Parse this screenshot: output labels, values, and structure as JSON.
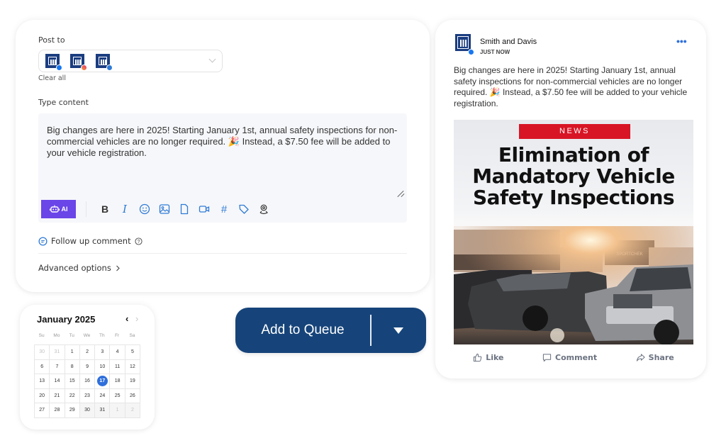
{
  "composer": {
    "post_to_label": "Post to",
    "accounts": [
      {
        "name": "Smith and Davis",
        "network": "facebook",
        "badge_color": "#1877f2"
      },
      {
        "name": "Smith and Davis",
        "network": "instagram",
        "badge_color": "#e1306c"
      },
      {
        "name": "Smith and Davis",
        "network": "linkedin",
        "badge_color": "#2f7bd6"
      }
    ],
    "clear_all": "Clear all",
    "type_content_label": "Type content",
    "content": "Big changes are here in 2025! Starting January 1st, annual safety inspections for non-commercial vehicles are no longer required. 🎉 Instead, a $7.50 fee will be added to your vehicle registration.",
    "toolbar": {
      "ai_label": "AI",
      "tools": [
        "bold-icon",
        "italic-icon",
        "emoji-icon",
        "image-icon",
        "file-icon",
        "video-icon",
        "hashtag-icon",
        "tag-icon",
        "location-icon"
      ],
      "bold_glyph": "B",
      "italic_glyph": "I",
      "hashtag_glyph": "#"
    },
    "follow_up_label": "Follow up comment",
    "advanced_label": "Advanced options",
    "ai_color": "#6a45e8",
    "icon_color": "#2f7bd6"
  },
  "calendar": {
    "title": "January 2025",
    "prev": "‹",
    "next": "›",
    "weekdays": [
      "Su",
      "Mo",
      "Tu",
      "We",
      "Th",
      "Fr",
      "Sa"
    ],
    "days": [
      {
        "d": "30",
        "muted": true
      },
      {
        "d": "31",
        "muted": true
      },
      {
        "d": "1"
      },
      {
        "d": "2"
      },
      {
        "d": "3"
      },
      {
        "d": "4"
      },
      {
        "d": "5"
      },
      {
        "d": "6"
      },
      {
        "d": "7"
      },
      {
        "d": "8"
      },
      {
        "d": "9"
      },
      {
        "d": "10"
      },
      {
        "d": "11"
      },
      {
        "d": "12"
      },
      {
        "d": "13"
      },
      {
        "d": "14"
      },
      {
        "d": "15"
      },
      {
        "d": "16"
      },
      {
        "d": "17",
        "selected": true
      },
      {
        "d": "18"
      },
      {
        "d": "19"
      },
      {
        "d": "20"
      },
      {
        "d": "21"
      },
      {
        "d": "22"
      },
      {
        "d": "23"
      },
      {
        "d": "24"
      },
      {
        "d": "25"
      },
      {
        "d": "26"
      },
      {
        "d": "27"
      },
      {
        "d": "28"
      },
      {
        "d": "29"
      },
      {
        "d": "30",
        "shade": true
      },
      {
        "d": "31",
        "shade": true
      },
      {
        "d": "1",
        "muted": true,
        "shade": true
      },
      {
        "d": "2",
        "muted": true,
        "shade": true
      }
    ],
    "selected_color": "#2f6fdc"
  },
  "queue_button": {
    "label": "Add to Queue",
    "color": "#16447a"
  },
  "preview": {
    "page_name": "Smith and Davis",
    "timestamp": "JUST NOW",
    "more": "•••",
    "text": "Big changes are here in 2025! Starting January 1st, annual safety inspections for non-commercial vehicles are no longer required. 🎉 Instead, a $7.50 fee will be added to your vehicle registration.",
    "image": {
      "tag": "NEWS",
      "headline": "Elimination of Mandatory Vehicle Safety Inspections",
      "tag_color": "#d81525",
      "photo_description": "pickup trucks parked in front of storefront at sunset",
      "store_sign": "SPORTCHEK"
    },
    "actions": [
      {
        "label": "Like",
        "icon": "thumbs-up-icon"
      },
      {
        "label": "Comment",
        "icon": "comment-icon"
      },
      {
        "label": "Share",
        "icon": "share-icon"
      }
    ]
  }
}
